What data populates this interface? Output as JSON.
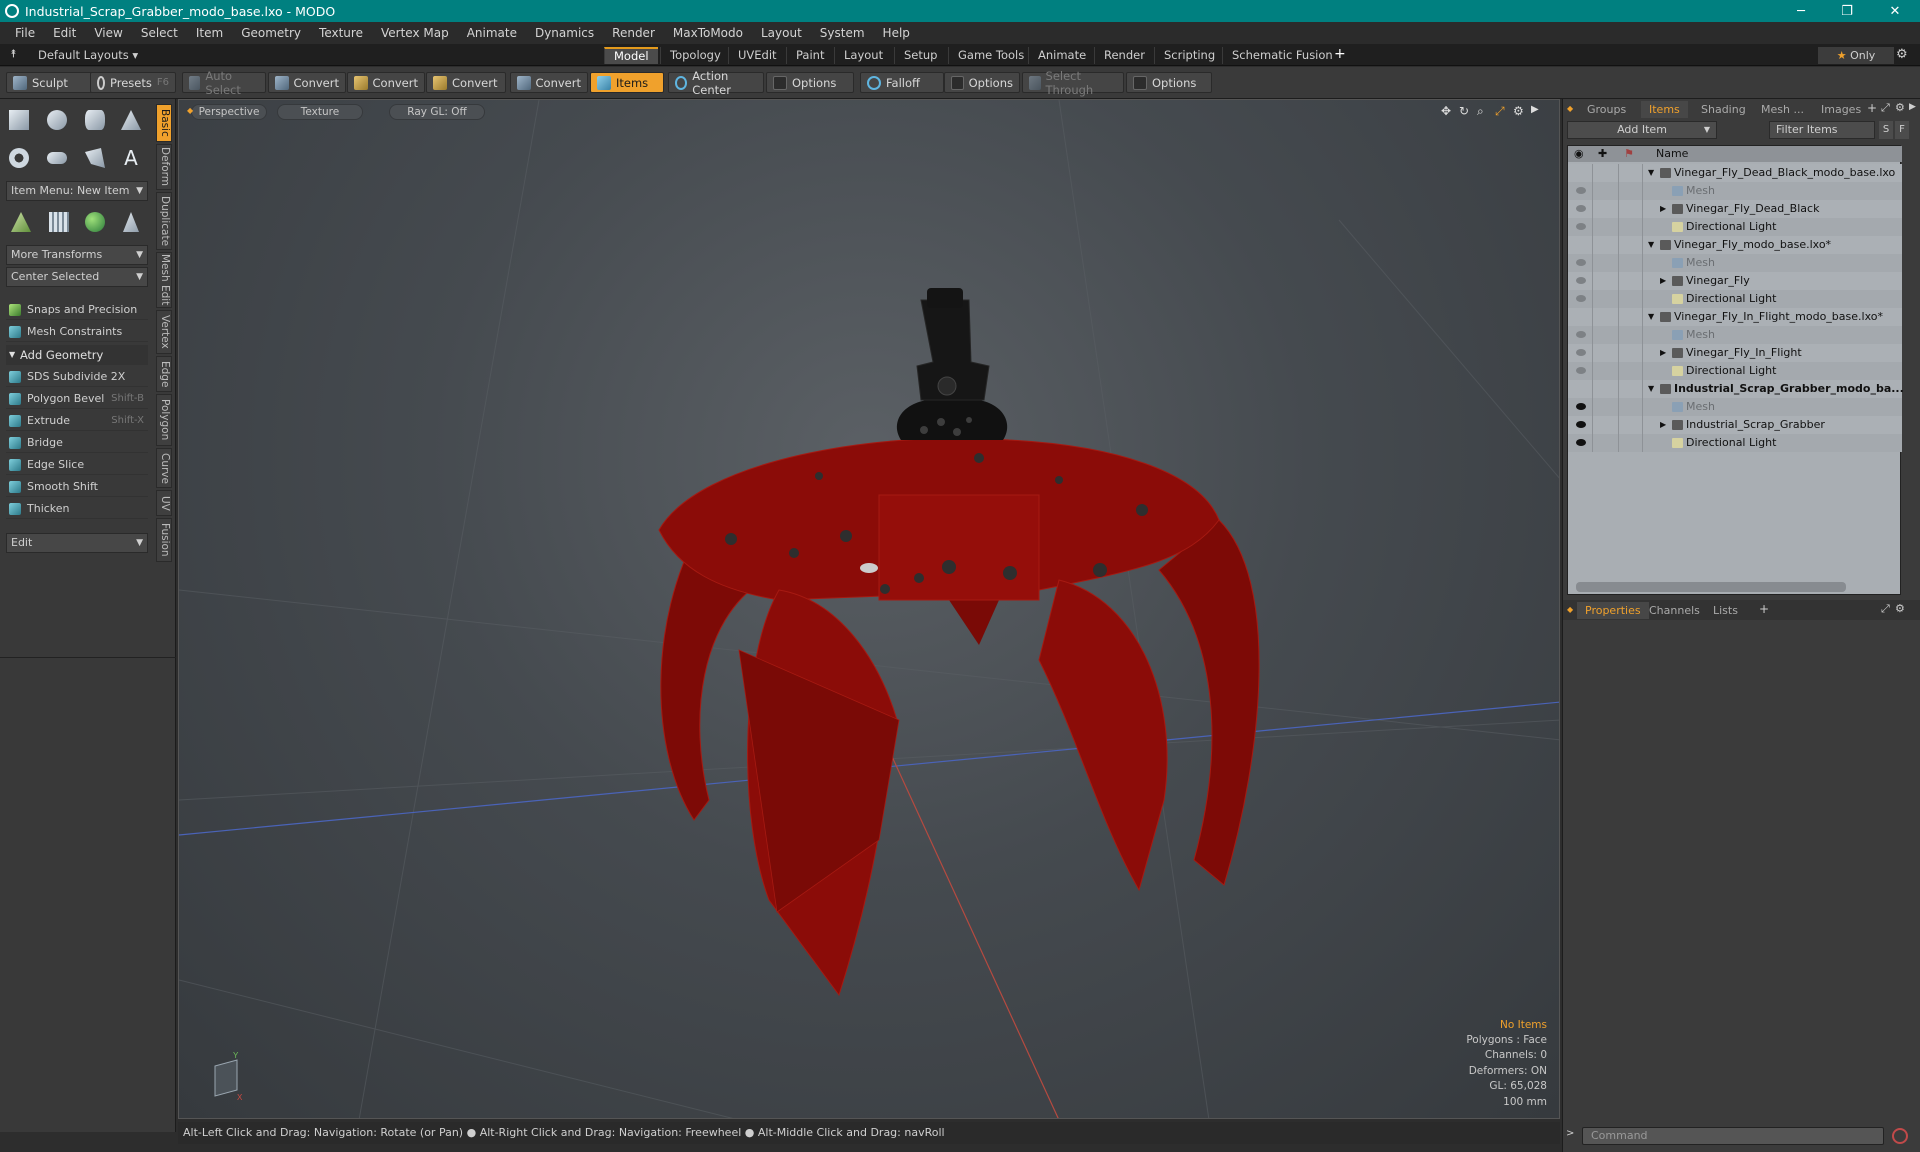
{
  "window": {
    "title": "Industrial_Scrap_Grabber_modo_base.lxo - MODO"
  },
  "menu": [
    "File",
    "Edit",
    "View",
    "Select",
    "Item",
    "Geometry",
    "Texture",
    "Vertex Map",
    "Animate",
    "Dynamics",
    "Render",
    "MaxToModo",
    "Layout",
    "System",
    "Help"
  ],
  "layouts": {
    "default": "Default Layouts",
    "only": "Only",
    "tabs": [
      "Model",
      "Topology",
      "UVEdit",
      "Paint",
      "Layout",
      "Setup",
      "Game Tools",
      "Animate",
      "Render",
      "Scripting",
      "Schematic Fusion"
    ],
    "active": "Model"
  },
  "toolbar": {
    "sculpt": "Sculpt",
    "presets": "Presets",
    "presets_key": "F6",
    "auto_select": "Auto Select",
    "convert": "Convert",
    "items": "Items",
    "action_center": "Action Center",
    "options": "Options",
    "falloff": "Falloff",
    "select_through": "Select Through"
  },
  "left": {
    "item_menu": "Item Menu: New Item",
    "more_transforms": "More Transforms",
    "center_selected": "Center Selected",
    "snaps": "Snaps and Precision",
    "constraints": "Mesh Constraints",
    "add_geometry": "Add Geometry",
    "tools": [
      {
        "label": "SDS Subdivide 2X",
        "key": ""
      },
      {
        "label": "Polygon Bevel",
        "key": "Shift-B"
      },
      {
        "label": "Extrude",
        "key": "Shift-X"
      },
      {
        "label": "Bridge",
        "key": ""
      },
      {
        "label": "Edge Slice",
        "key": ""
      },
      {
        "label": "Smooth Shift",
        "key": ""
      },
      {
        "label": "Thicken",
        "key": ""
      }
    ],
    "edit": "Edit",
    "vtabs": [
      "Basic",
      "Deform",
      "Duplicate",
      "Mesh Edit",
      "Vertex",
      "Edge",
      "Polygon",
      "Curve",
      "UV",
      "Fusion"
    ]
  },
  "viewport": {
    "view": "Perspective",
    "shading": "Texture",
    "raygl": "Ray GL: Off",
    "info": [
      "No Items",
      "Polygons : Face",
      "Channels: 0",
      "Deformers: ON",
      "GL: 65,028",
      "100 mm"
    ]
  },
  "status": "Alt-Left Click and Drag: Navigation: Rotate (or Pan) ● Alt-Right Click and Drag: Navigation: Freewheel ● Alt-Middle Click and Drag: navRoll",
  "right": {
    "tabs": [
      "Groups",
      "Items",
      "Shading",
      "Mesh ...",
      "Images"
    ],
    "add_item": "Add Item",
    "filter": "Filter Items",
    "s": "S",
    "f": "F",
    "name_col": "Name",
    "items": [
      {
        "name": "Vinegar_Fly_Dead_Black_modo_base.lxo",
        "lvl": 0,
        "tw": "▼",
        "kind": "scene"
      },
      {
        "name": "Mesh",
        "lvl": 1,
        "tw": "",
        "kind": "mesh"
      },
      {
        "name": "Vinegar_Fly_Dead_Black",
        "lvl": 1,
        "tw": "▶",
        "kind": "loc"
      },
      {
        "name": "Directional Light",
        "lvl": 1,
        "tw": "",
        "kind": "light"
      },
      {
        "name": "Vinegar_Fly_modo_base.lxo*",
        "lvl": 0,
        "tw": "▼",
        "kind": "scene"
      },
      {
        "name": "Mesh",
        "lvl": 1,
        "tw": "",
        "kind": "mesh"
      },
      {
        "name": "Vinegar_Fly",
        "lvl": 1,
        "tw": "▶",
        "kind": "loc"
      },
      {
        "name": "Directional Light",
        "lvl": 1,
        "tw": "",
        "kind": "light"
      },
      {
        "name": "Vinegar_Fly_In_Flight_modo_base.lxo*",
        "lvl": 0,
        "tw": "▼",
        "kind": "scene"
      },
      {
        "name": "Mesh",
        "lvl": 1,
        "tw": "",
        "kind": "mesh"
      },
      {
        "name": "Vinegar_Fly_In_Flight",
        "lvl": 1,
        "tw": "▶",
        "kind": "loc"
      },
      {
        "name": "Directional Light",
        "lvl": 1,
        "tw": "",
        "kind": "light"
      },
      {
        "name": "Industrial_Scrap_Grabber_modo_ba...",
        "lvl": 0,
        "tw": "▼",
        "kind": "scene"
      },
      {
        "name": "Mesh",
        "lvl": 1,
        "tw": "",
        "kind": "mesh"
      },
      {
        "name": "Industrial_Scrap_Grabber",
        "lvl": 1,
        "tw": "▶",
        "kind": "loc"
      },
      {
        "name": "Directional Light",
        "lvl": 1,
        "tw": "",
        "kind": "light"
      }
    ],
    "bottom_tabs": [
      "Properties",
      "Channels",
      "Lists"
    ],
    "command": "Command"
  },
  "colors": {
    "accent": "#f0a12c",
    "titlebar": "#008080",
    "model_red": "#8b0c08"
  }
}
